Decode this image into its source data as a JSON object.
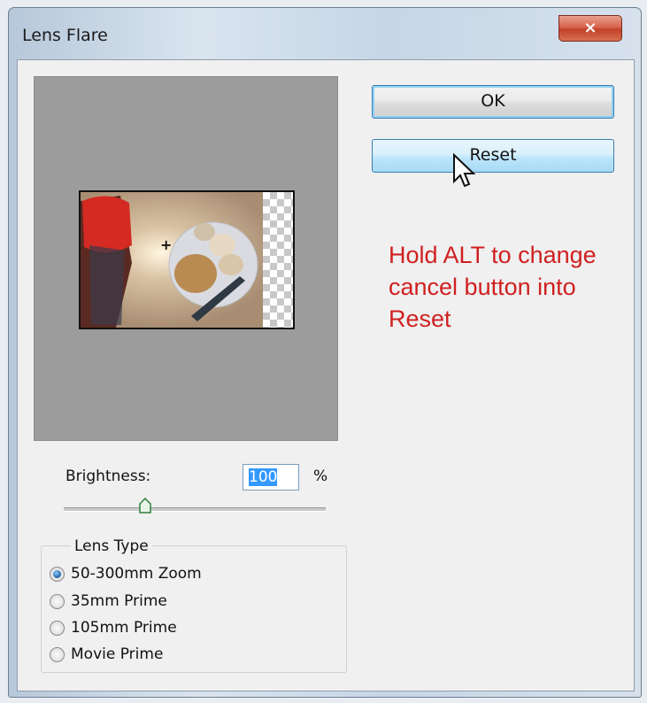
{
  "window": {
    "title": "Lens Flare",
    "close_icon": "×"
  },
  "buttons": {
    "ok_label": "OK",
    "reset_label": "Reset"
  },
  "annotation": {
    "text": "Hold ALT to change cancel button into Reset",
    "color": "#d02020"
  },
  "brightness": {
    "label": "Brightness:",
    "value": "100",
    "unit": "%"
  },
  "lens_type": {
    "legend": "Lens Type",
    "options": [
      {
        "label": "50-300mm Zoom",
        "checked": true
      },
      {
        "label": "35mm Prime",
        "checked": false
      },
      {
        "label": "105mm Prime",
        "checked": false
      },
      {
        "label": "Movie Prime",
        "checked": false
      }
    ]
  },
  "colors": {
    "accent": "#3399ff",
    "close_button": "#c2412a"
  }
}
